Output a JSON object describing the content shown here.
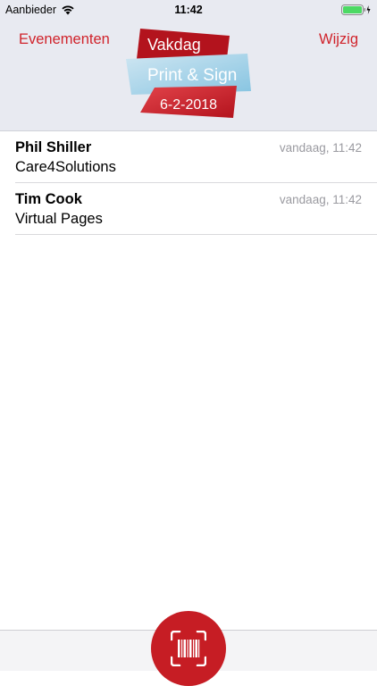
{
  "status_bar": {
    "carrier": "Aanbieder",
    "time": "11:42"
  },
  "nav": {
    "left_label": "Evenementen",
    "right_label": "Wijzig"
  },
  "logo": {
    "line1": "Vakdag",
    "line2": "Print & Sign",
    "date": "6-2-2018"
  },
  "contacts": [
    {
      "name": "Phil Shiller",
      "company": "Care4Solutions",
      "time": "vandaag, 11:42"
    },
    {
      "name": "Tim Cook",
      "company": "Virtual Pages",
      "time": "vandaag, 11:42"
    }
  ],
  "colors": {
    "accent": "#d0232b",
    "nav_background": "#e8eaf1",
    "scan_button": "#c61d24"
  },
  "icons": {
    "wifi": "wifi-icon",
    "battery": "battery-icon",
    "scan": "barcode-scan-icon"
  }
}
